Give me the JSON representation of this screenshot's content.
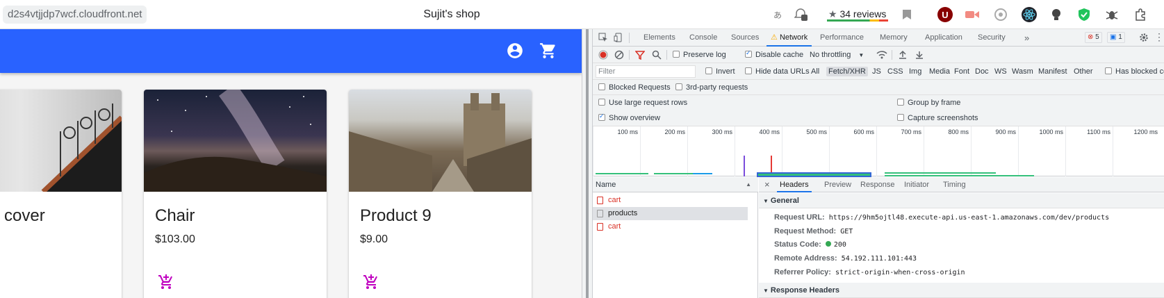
{
  "browser": {
    "url": "d2s4vtjjdp7wcf.cloudfront.net",
    "title": "Sujit's shop",
    "reviews": "34 reviews",
    "reviews_star": "★"
  },
  "shop": {
    "accent": "#2962ff",
    "cart_color": "#c000c0",
    "products": [
      {
        "name": "cover",
        "price": ""
      },
      {
        "name": "Chair",
        "price": "$103.00"
      },
      {
        "name": "Product 9",
        "price": "$9.00"
      }
    ]
  },
  "devtools": {
    "tabs": [
      "Elements",
      "Console",
      "Sources",
      "Network",
      "Performance",
      "Memory",
      "Application",
      "Security"
    ],
    "active_tab": "Network",
    "more": "»",
    "errors_count": "5",
    "messages_count": "1",
    "toolbar": {
      "preserve_log": "Preserve log",
      "disable_cache": "Disable cache",
      "throttling": "No throttling"
    },
    "filter_placeholder": "Filter",
    "invert": "Invert",
    "hide_data_urls": "Hide data URLs",
    "filter_types": [
      "All",
      "Fetch/XHR",
      "JS",
      "CSS",
      "Img",
      "Media",
      "Font",
      "Doc",
      "WS",
      "Wasm",
      "Manifest",
      "Other"
    ],
    "active_filter": "Fetch/XHR",
    "has_blocked": "Has blocked co",
    "blocked_requests": "Blocked Requests",
    "third_party": "3rd-party requests",
    "large_rows": "Use large request rows",
    "group_by_frame": "Group by frame",
    "show_overview": "Show overview",
    "capture_screenshots": "Capture screenshots",
    "timeline_ticks": [
      "100 ms",
      "200 ms",
      "300 ms",
      "400 ms",
      "500 ms",
      "600 ms",
      "700 ms",
      "800 ms",
      "900 ms",
      "1000 ms",
      "1100 ms",
      "1200 ms"
    ],
    "name_header": "Name",
    "requests": [
      {
        "name": "cart",
        "status": "error"
      },
      {
        "name": "products",
        "status": "selected"
      },
      {
        "name": "cart",
        "status": "error"
      }
    ],
    "detail_tabs": [
      "Headers",
      "Preview",
      "Response",
      "Initiator",
      "Timing"
    ],
    "active_detail_tab": "Headers",
    "close_glyph": "×",
    "general_label": "General",
    "general": [
      {
        "key": "Request URL:",
        "value": "https://9hm5ojtl48.execute-api.us-east-1.amazonaws.com/dev/products"
      },
      {
        "key": "Request Method:",
        "value": "GET"
      },
      {
        "key": "Status Code:",
        "value": "200"
      },
      {
        "key": "Remote Address:",
        "value": "54.192.111.101:443"
      },
      {
        "key": "Referrer Policy:",
        "value": "strict-origin-when-cross-origin"
      }
    ],
    "response_headers_label": "Response Headers"
  }
}
